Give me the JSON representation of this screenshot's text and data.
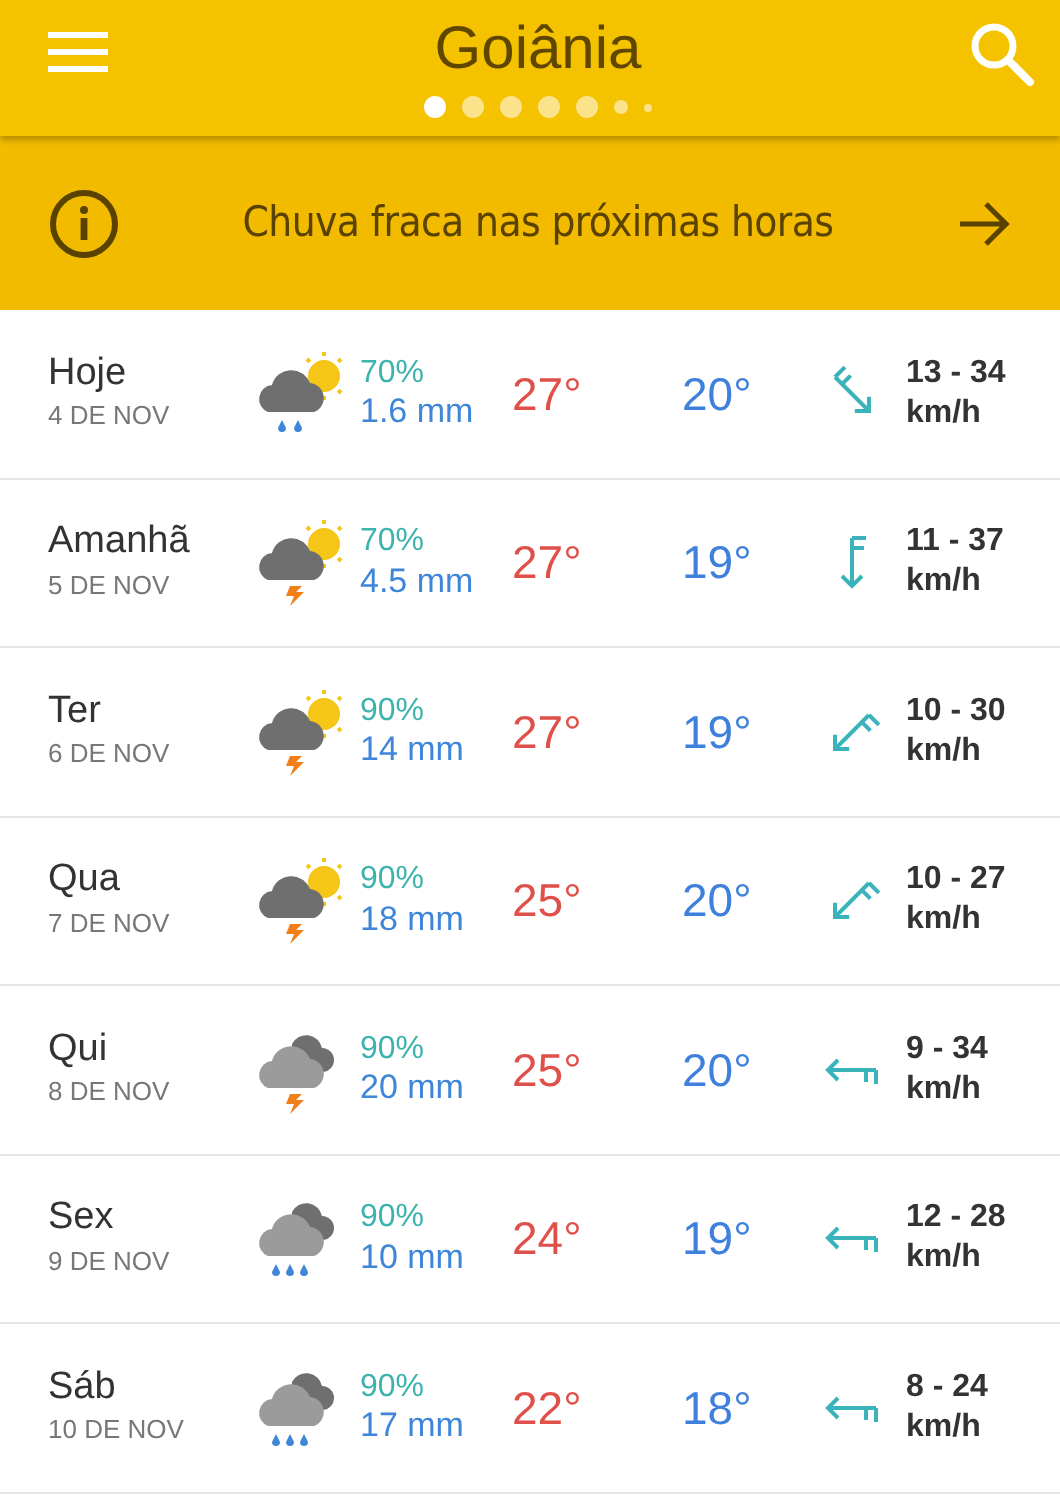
{
  "header": {
    "title": "Goiânia",
    "pages": [
      {
        "selected": true
      },
      {
        "selected": false
      },
      {
        "selected": false
      },
      {
        "selected": false
      },
      {
        "selected": false
      },
      {
        "selected": false
      },
      {
        "selected": false
      }
    ]
  },
  "alert": {
    "text": "Chuva fraca nas próximas horas"
  },
  "days": [
    {
      "day": "Hoje",
      "date": "4 DE NOV",
      "icon": {
        "kind": "partly-rain"
      },
      "chance": "70%",
      "amount": "1.6 mm",
      "high": "27°",
      "low": "20°",
      "wind_arrow": {
        "kind": "se"
      },
      "wind": "13 - 34",
      "unit": "km/h"
    },
    {
      "day": "Amanhã",
      "date": "5 DE NOV",
      "icon": {
        "kind": "partly-storm"
      },
      "chance": "70%",
      "amount": "4.5 mm",
      "high": "27°",
      "low": "19°",
      "wind_arrow": {
        "kind": "s"
      },
      "wind": "11 - 37",
      "unit": "km/h"
    },
    {
      "day": "Ter",
      "date": "6 DE NOV",
      "icon": {
        "kind": "partly-storm"
      },
      "chance": "90%",
      "amount": "14 mm",
      "high": "27°",
      "low": "19°",
      "wind_arrow": {
        "kind": "sw"
      },
      "wind": "10 - 30",
      "unit": "km/h"
    },
    {
      "day": "Qua",
      "date": "7 DE NOV",
      "icon": {
        "kind": "partly-storm"
      },
      "chance": "90%",
      "amount": "18 mm",
      "high": "25°",
      "low": "20°",
      "wind_arrow": {
        "kind": "sw"
      },
      "wind": "10 - 27",
      "unit": "km/h"
    },
    {
      "day": "Qui",
      "date": "8 DE NOV",
      "icon": {
        "kind": "cloudy-storm"
      },
      "chance": "90%",
      "amount": "20 mm",
      "high": "25°",
      "low": "20°",
      "wind_arrow": {
        "kind": "w"
      },
      "wind": "9 - 34",
      "unit": "km/h"
    },
    {
      "day": "Sex",
      "date": "9 DE NOV",
      "icon": {
        "kind": "cloudy-rain"
      },
      "chance": "90%",
      "amount": "10 mm",
      "high": "24°",
      "low": "19°",
      "wind_arrow": {
        "kind": "w"
      },
      "wind": "12 - 28",
      "unit": "km/h"
    },
    {
      "day": "Sáb",
      "date": "10 DE NOV",
      "icon": {
        "kind": "cloudy-rain"
      },
      "chance": "90%",
      "amount": "17 mm",
      "high": "22°",
      "low": "18°",
      "wind_arrow": {
        "kind": "w"
      },
      "wind": "8 - 24",
      "unit": "km/h"
    }
  ]
}
